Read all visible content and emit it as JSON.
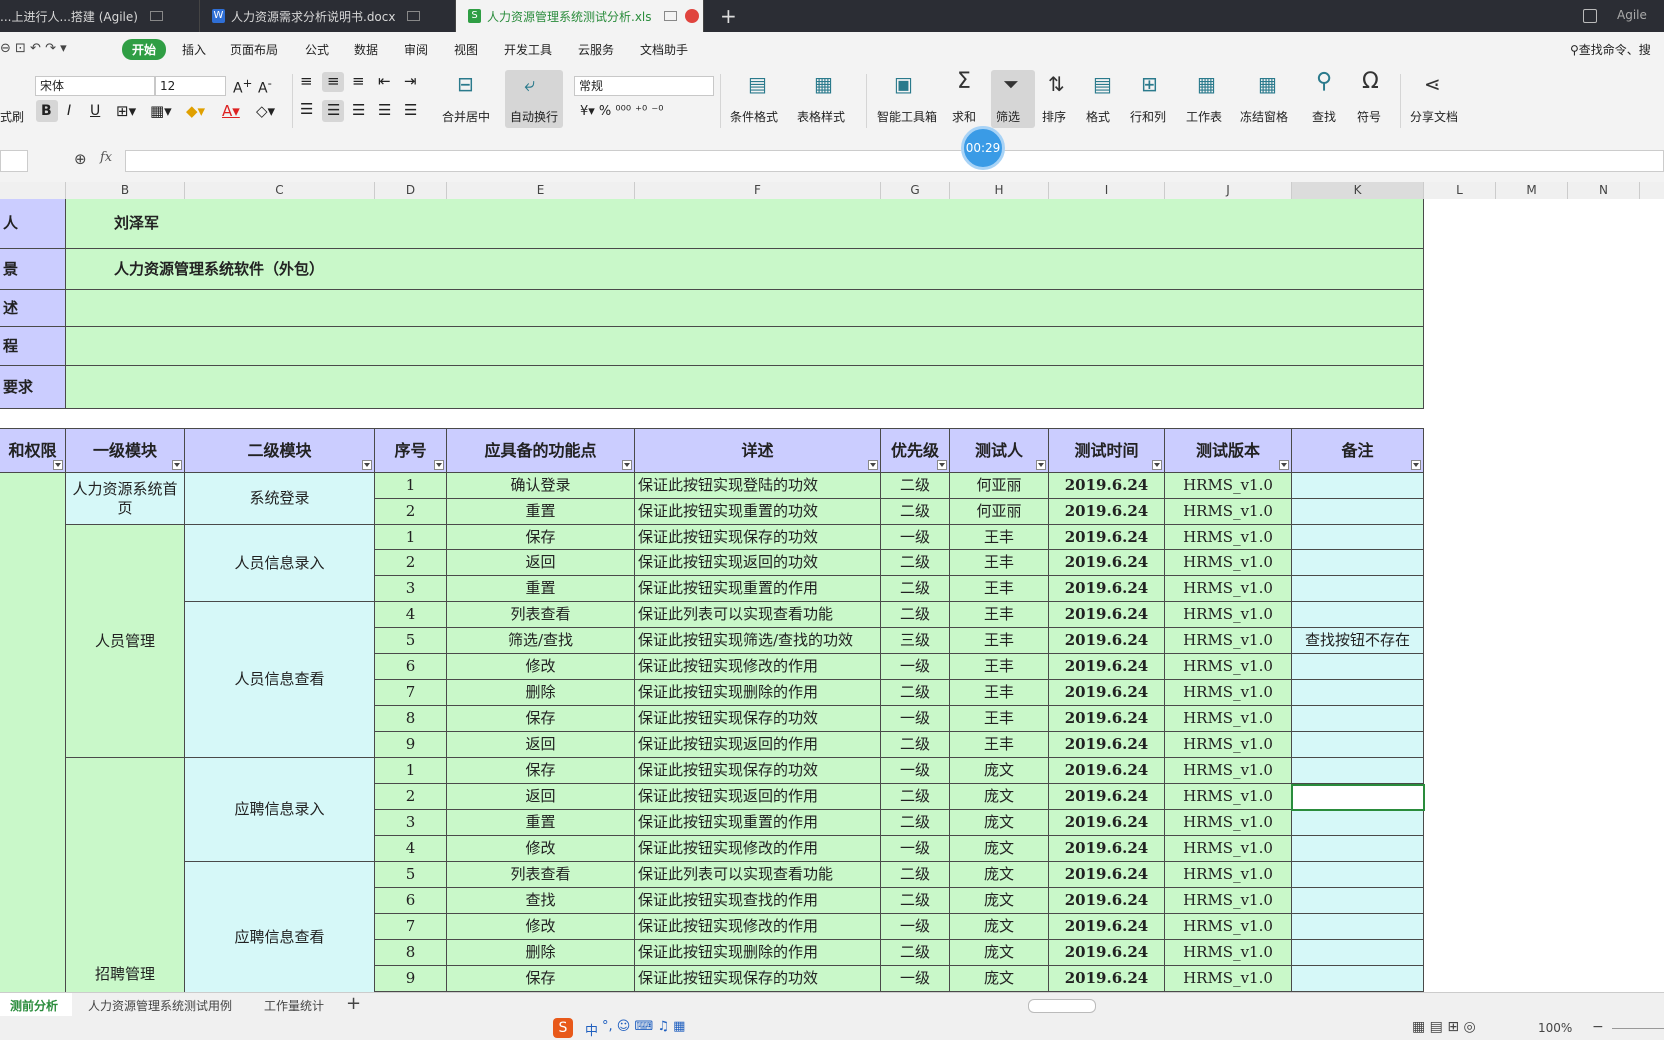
{
  "tabs": [
    {
      "label": "...上进行人...搭建 (Agile)",
      "active": false
    },
    {
      "label": "人力资源需求分析说明书.docx",
      "active": false
    },
    {
      "label": "人力资源管理系统测试分析.xls",
      "active": true
    }
  ],
  "window": {
    "user": "Agile"
  },
  "menu": [
    "开始",
    "插入",
    "页面布局",
    "公式",
    "数据",
    "审阅",
    "视图",
    "开发工具",
    "云服务",
    "文档助手"
  ],
  "search_command": "查找命令、搜",
  "ribbon": {
    "font_name": "宋体",
    "font_size": "12",
    "number_format": "常规",
    "format_painter": "式刷",
    "merge_center": "合并居中",
    "wrap_text": "自动换行",
    "conditional_format": "条件格式",
    "table_style": "表格样式",
    "smart_toolbox": "智能工具箱",
    "sum": "求和",
    "filter": "筛选",
    "sort": "排序",
    "format": "格式",
    "row_col": "行和列",
    "worksheet": "工作表",
    "freeze": "冻结窗格",
    "find": "查找",
    "symbol": "符号",
    "share": "分享文档"
  },
  "timer": "00:29",
  "formula": {
    "fx": "fx",
    "value": ""
  },
  "columns": [
    "B",
    "C",
    "D",
    "E",
    "F",
    "G",
    "H",
    "I",
    "J",
    "K",
    "L",
    "M",
    "N"
  ],
  "info": [
    {
      "label": "人",
      "value": "刘泽军"
    },
    {
      "label": "景",
      "value": "人力资源管理系统软件（外包）"
    },
    {
      "label": "述",
      "value": ""
    },
    {
      "label": "程",
      "value": ""
    },
    {
      "label": "要求",
      "value": ""
    }
  ],
  "headers": [
    "和权限",
    "一级模块",
    "二级模块",
    "序号",
    "应具备的功能点",
    "详述",
    "优先级",
    "测试人",
    "测试时间",
    "测试版本",
    "备注"
  ],
  "groups": {
    "level1": [
      "人力资源系统首页",
      "人员管理",
      "招聘管理"
    ],
    "level2": [
      "系统登录",
      "人员信息录入",
      "人员信息查看",
      "应聘信息录入",
      "应聘信息查看"
    ]
  },
  "rows": [
    {
      "no": "1",
      "func": "确认登录",
      "detail": "保证此按钮实现登陆的功效",
      "priority": "二级",
      "tester": "何亚丽",
      "date": "2019.6.24",
      "version": "HRMS_v1.0",
      "remark": ""
    },
    {
      "no": "2",
      "func": "重置",
      "detail": "保证此按钮实现重置的功效",
      "priority": "二级",
      "tester": "何亚丽",
      "date": "2019.6.24",
      "version": "HRMS_v1.0",
      "remark": ""
    },
    {
      "no": "1",
      "func": "保存",
      "detail": "保证此按钮实现保存的功效",
      "priority": "一级",
      "tester": "王丰",
      "date": "2019.6.24",
      "version": "HRMS_v1.0",
      "remark": ""
    },
    {
      "no": "2",
      "func": "返回",
      "detail": "保证此按钮实现返回的功效",
      "priority": "二级",
      "tester": "王丰",
      "date": "2019.6.24",
      "version": "HRMS_v1.0",
      "remark": ""
    },
    {
      "no": "3",
      "func": "重置",
      "detail": "保证此按钮实现重置的作用",
      "priority": "二级",
      "tester": "王丰",
      "date": "2019.6.24",
      "version": "HRMS_v1.0",
      "remark": ""
    },
    {
      "no": "4",
      "func": "列表查看",
      "detail": "保证此列表可以实现查看功能",
      "priority": "二级",
      "tester": "王丰",
      "date": "2019.6.24",
      "version": "HRMS_v1.0",
      "remark": ""
    },
    {
      "no": "5",
      "func": "筛选/查找",
      "detail": "保证此按钮实现筛选/查找的功效",
      "priority": "三级",
      "tester": "王丰",
      "date": "2019.6.24",
      "version": "HRMS_v1.0",
      "remark": "查找按钮不存在"
    },
    {
      "no": "6",
      "func": "修改",
      "detail": "保证此按钮实现修改的作用",
      "priority": "一级",
      "tester": "王丰",
      "date": "2019.6.24",
      "version": "HRMS_v1.0",
      "remark": ""
    },
    {
      "no": "7",
      "func": "删除",
      "detail": "保证此按钮实现删除的作用",
      "priority": "二级",
      "tester": "王丰",
      "date": "2019.6.24",
      "version": "HRMS_v1.0",
      "remark": ""
    },
    {
      "no": "8",
      "func": "保存",
      "detail": "保证此按钮实现保存的功效",
      "priority": "一级",
      "tester": "王丰",
      "date": "2019.6.24",
      "version": "HRMS_v1.0",
      "remark": ""
    },
    {
      "no": "9",
      "func": "返回",
      "detail": "保证此按钮实现返回的作用",
      "priority": "二级",
      "tester": "王丰",
      "date": "2019.6.24",
      "version": "HRMS_v1.0",
      "remark": ""
    },
    {
      "no": "1",
      "func": "保存",
      "detail": "保证此按钮实现保存的功效",
      "priority": "一级",
      "tester": "庞文",
      "date": "2019.6.24",
      "version": "HRMS_v1.0",
      "remark": ""
    },
    {
      "no": "2",
      "func": "返回",
      "detail": "保证此按钮实现返回的作用",
      "priority": "二级",
      "tester": "庞文",
      "date": "2019.6.24",
      "version": "HRMS_v1.0",
      "remark": ""
    },
    {
      "no": "3",
      "func": "重置",
      "detail": "保证此按钮实现重置的作用",
      "priority": "二级",
      "tester": "庞文",
      "date": "2019.6.24",
      "version": "HRMS_v1.0",
      "remark": ""
    },
    {
      "no": "4",
      "func": "修改",
      "detail": "保证此按钮实现修改的作用",
      "priority": "一级",
      "tester": "庞文",
      "date": "2019.6.24",
      "version": "HRMS_v1.0",
      "remark": ""
    },
    {
      "no": "5",
      "func": "列表查看",
      "detail": "保证此列表可以实现查看功能",
      "priority": "二级",
      "tester": "庞文",
      "date": "2019.6.24",
      "version": "HRMS_v1.0",
      "remark": ""
    },
    {
      "no": "6",
      "func": "查找",
      "detail": "保证此按钮实现查找的作用",
      "priority": "二级",
      "tester": "庞文",
      "date": "2019.6.24",
      "version": "HRMS_v1.0",
      "remark": ""
    },
    {
      "no": "7",
      "func": "修改",
      "detail": "保证此按钮实现修改的作用",
      "priority": "一级",
      "tester": "庞文",
      "date": "2019.6.24",
      "version": "HRMS_v1.0",
      "remark": ""
    },
    {
      "no": "8",
      "func": "删除",
      "detail": "保证此按钮实现删除的作用",
      "priority": "二级",
      "tester": "庞文",
      "date": "2019.6.24",
      "version": "HRMS_v1.0",
      "remark": ""
    },
    {
      "no": "9",
      "func": "保存",
      "detail": "保证此按钮实现保存的功效",
      "priority": "一级",
      "tester": "庞文",
      "date": "2019.6.24",
      "version": "HRMS_v1.0",
      "remark": ""
    }
  ],
  "sheets": [
    "测前分析",
    "人力资源管理系统测试用例",
    "工作量统计"
  ],
  "zoom": "100%",
  "ime": "中"
}
